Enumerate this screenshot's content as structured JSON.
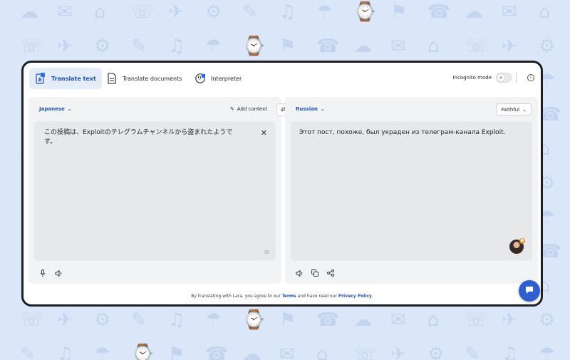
{
  "tabs": [
    {
      "label": "Translate text",
      "icon": "translate-text-icon",
      "active": true
    },
    {
      "label": "Translate documents",
      "icon": "document-icon",
      "active": false
    },
    {
      "label": "Interpreter",
      "icon": "interpreter-icon",
      "active": false
    }
  ],
  "incognito": {
    "label": "Incognito mode",
    "enabled": false
  },
  "source": {
    "language": "Japanese",
    "add_context_label": "Add context",
    "text": "この投稿は、Exploitのテレグラムチャンネルから盗まれたようです。",
    "char_count": "35"
  },
  "target": {
    "language": "Russian",
    "style": "Faithful",
    "text": "Этот пост, похоже, был украден из телеграм-канала Exploit."
  },
  "footer": {
    "prefix": "By translating with Lara, you agree to our",
    "terms": "Terms",
    "middle": "and have read our",
    "privacy": "Privacy Policy",
    "suffix": "."
  },
  "colors": {
    "accent": "#2450b4",
    "background": "#dbe7f8",
    "panel": "#f2f3f5",
    "chat_button": "#2f5fcf"
  }
}
